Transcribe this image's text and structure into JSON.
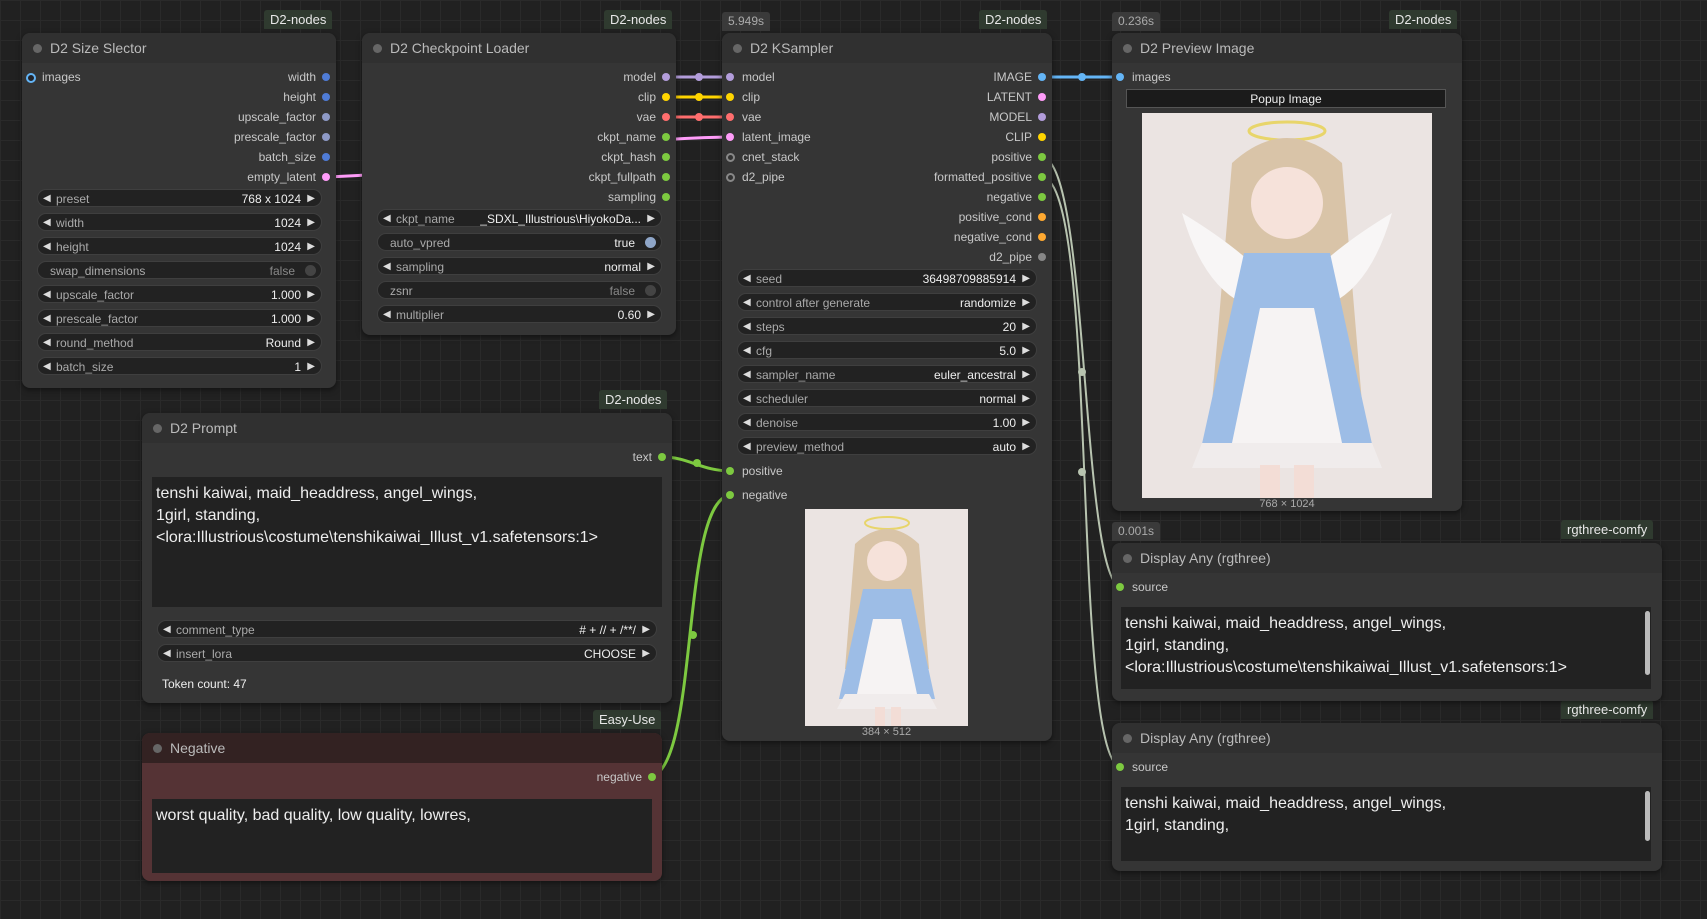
{
  "badges": {
    "size_selector": "D2-nodes",
    "checkpoint_loader": "D2-nodes",
    "ksampler": "D2-nodes",
    "preview_image": "D2-nodes",
    "prompt": "D2-nodes",
    "negative": "Easy-Use",
    "display_any_1": "rgthree-comfy",
    "display_any_2": "rgthree-comfy"
  },
  "timers": {
    "ksampler": "5.949s",
    "preview_image": "0.236s",
    "display_any_1": "0.001s"
  },
  "size_selector": {
    "title": "D2 Size Slector",
    "input_images": "images",
    "outputs": [
      "width",
      "height",
      "upscale_factor",
      "prescale_factor",
      "batch_size",
      "empty_latent"
    ],
    "widgets": [
      {
        "label": "preset",
        "value": "768 x 1024"
      },
      {
        "label": "width",
        "value": "1024"
      },
      {
        "label": "height",
        "value": "1024"
      },
      {
        "label": "swap_dimensions",
        "value": "false"
      },
      {
        "label": "upscale_factor",
        "value": "1.000"
      },
      {
        "label": "prescale_factor",
        "value": "1.000"
      },
      {
        "label": "round_method",
        "value": "Round"
      },
      {
        "label": "batch_size",
        "value": "1"
      }
    ]
  },
  "checkpoint_loader": {
    "title": "D2 Checkpoint Loader",
    "outputs": [
      "model",
      "clip",
      "vae",
      "ckpt_name",
      "ckpt_hash",
      "ckpt_fullpath",
      "sampling"
    ],
    "widgets": [
      {
        "label": "ckpt_name",
        "value": "_SDXL_Illustrious\\HiyokoDa..."
      },
      {
        "label": "auto_vpred",
        "value": "true"
      },
      {
        "label": "sampling",
        "value": "normal"
      },
      {
        "label": "zsnr",
        "value": "false"
      },
      {
        "label": "multiplier",
        "value": "0.60"
      }
    ]
  },
  "ksampler": {
    "title": "D2 KSampler",
    "inputs": [
      "model",
      "clip",
      "vae",
      "latent_image",
      "cnet_stack",
      "d2_pipe"
    ],
    "outputs": [
      "IMAGE",
      "LATENT",
      "MODEL",
      "CLIP",
      "positive",
      "formatted_positive",
      "negative",
      "positive_cond",
      "negative_cond",
      "d2_pipe"
    ],
    "widgets": [
      {
        "label": "seed",
        "value": "36498709885914"
      },
      {
        "label": "control after generate",
        "value": "randomize"
      },
      {
        "label": "steps",
        "value": "20"
      },
      {
        "label": "cfg",
        "value": "5.0"
      },
      {
        "label": "sampler_name",
        "value": "euler_ancestral"
      },
      {
        "label": "scheduler",
        "value": "normal"
      },
      {
        "label": "denoise",
        "value": "1.00"
      },
      {
        "label": "preview_method",
        "value": "auto"
      }
    ],
    "input_positive": "positive",
    "input_negative": "negative",
    "image_caption": "384 × 512"
  },
  "preview_image": {
    "title": "D2 Preview Image",
    "input_images": "images",
    "popup_button": "Popup Image",
    "image_caption": "768 × 1024"
  },
  "prompt": {
    "title": "D2 Prompt",
    "output_text": "text",
    "text": "tenshi kaiwai, maid_headdress, angel_wings,\n1girl, standing,\n<lora:Illustrious\\costume\\tenshikaiwai_Illust_v1.safetensors:1>",
    "widgets": [
      {
        "label": "comment_type",
        "value": "# + // + /**/"
      },
      {
        "label": "insert_lora",
        "value": "CHOOSE"
      }
    ],
    "token_count": "Token count: 47"
  },
  "negative": {
    "title": "Negative",
    "output": "negative",
    "text": "worst quality, bad quality, low quality, lowres,"
  },
  "display_any_1": {
    "title": "Display Any (rgthree)",
    "input": "source",
    "text": "tenshi kaiwai, maid_headdress, angel_wings,\n1girl, standing,\n<lora:Illustrious\\costume\\tenshikaiwai_Illust_v1.safetensors:1>"
  },
  "display_any_2": {
    "title": "Display Any (rgthree)",
    "input": "source",
    "text": "tenshi kaiwai, maid_headdress, angel_wings,\n1girl, standing,"
  },
  "colors": {
    "model": "#b39ddb",
    "clip": "#ffd500",
    "vae": "#ff6e6e",
    "latent": "#ff9cf9",
    "image": "#64b5f6",
    "conditioning": "#ffa931",
    "string": "#7dc940",
    "int": "#4f7cd6",
    "float": "#8e9ac7",
    "any": "#b8c4b0"
  }
}
